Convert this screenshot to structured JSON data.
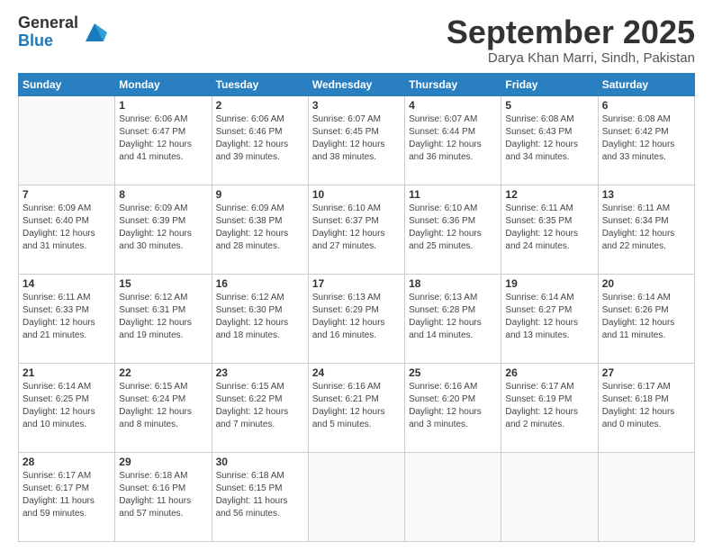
{
  "header": {
    "logo_general": "General",
    "logo_blue": "Blue",
    "title": "September 2025",
    "subtitle": "Darya Khan Marri, Sindh, Pakistan"
  },
  "days_of_week": [
    "Sunday",
    "Monday",
    "Tuesday",
    "Wednesday",
    "Thursday",
    "Friday",
    "Saturday"
  ],
  "weeks": [
    [
      {
        "day": "",
        "info": ""
      },
      {
        "day": "1",
        "info": "Sunrise: 6:06 AM\nSunset: 6:47 PM\nDaylight: 12 hours\nand 41 minutes."
      },
      {
        "day": "2",
        "info": "Sunrise: 6:06 AM\nSunset: 6:46 PM\nDaylight: 12 hours\nand 39 minutes."
      },
      {
        "day": "3",
        "info": "Sunrise: 6:07 AM\nSunset: 6:45 PM\nDaylight: 12 hours\nand 38 minutes."
      },
      {
        "day": "4",
        "info": "Sunrise: 6:07 AM\nSunset: 6:44 PM\nDaylight: 12 hours\nand 36 minutes."
      },
      {
        "day": "5",
        "info": "Sunrise: 6:08 AM\nSunset: 6:43 PM\nDaylight: 12 hours\nand 34 minutes."
      },
      {
        "day": "6",
        "info": "Sunrise: 6:08 AM\nSunset: 6:42 PM\nDaylight: 12 hours\nand 33 minutes."
      }
    ],
    [
      {
        "day": "7",
        "info": "Sunrise: 6:09 AM\nSunset: 6:40 PM\nDaylight: 12 hours\nand 31 minutes."
      },
      {
        "day": "8",
        "info": "Sunrise: 6:09 AM\nSunset: 6:39 PM\nDaylight: 12 hours\nand 30 minutes."
      },
      {
        "day": "9",
        "info": "Sunrise: 6:09 AM\nSunset: 6:38 PM\nDaylight: 12 hours\nand 28 minutes."
      },
      {
        "day": "10",
        "info": "Sunrise: 6:10 AM\nSunset: 6:37 PM\nDaylight: 12 hours\nand 27 minutes."
      },
      {
        "day": "11",
        "info": "Sunrise: 6:10 AM\nSunset: 6:36 PM\nDaylight: 12 hours\nand 25 minutes."
      },
      {
        "day": "12",
        "info": "Sunrise: 6:11 AM\nSunset: 6:35 PM\nDaylight: 12 hours\nand 24 minutes."
      },
      {
        "day": "13",
        "info": "Sunrise: 6:11 AM\nSunset: 6:34 PM\nDaylight: 12 hours\nand 22 minutes."
      }
    ],
    [
      {
        "day": "14",
        "info": "Sunrise: 6:11 AM\nSunset: 6:33 PM\nDaylight: 12 hours\nand 21 minutes."
      },
      {
        "day": "15",
        "info": "Sunrise: 6:12 AM\nSunset: 6:31 PM\nDaylight: 12 hours\nand 19 minutes."
      },
      {
        "day": "16",
        "info": "Sunrise: 6:12 AM\nSunset: 6:30 PM\nDaylight: 12 hours\nand 18 minutes."
      },
      {
        "day": "17",
        "info": "Sunrise: 6:13 AM\nSunset: 6:29 PM\nDaylight: 12 hours\nand 16 minutes."
      },
      {
        "day": "18",
        "info": "Sunrise: 6:13 AM\nSunset: 6:28 PM\nDaylight: 12 hours\nand 14 minutes."
      },
      {
        "day": "19",
        "info": "Sunrise: 6:14 AM\nSunset: 6:27 PM\nDaylight: 12 hours\nand 13 minutes."
      },
      {
        "day": "20",
        "info": "Sunrise: 6:14 AM\nSunset: 6:26 PM\nDaylight: 12 hours\nand 11 minutes."
      }
    ],
    [
      {
        "day": "21",
        "info": "Sunrise: 6:14 AM\nSunset: 6:25 PM\nDaylight: 12 hours\nand 10 minutes."
      },
      {
        "day": "22",
        "info": "Sunrise: 6:15 AM\nSunset: 6:24 PM\nDaylight: 12 hours\nand 8 minutes."
      },
      {
        "day": "23",
        "info": "Sunrise: 6:15 AM\nSunset: 6:22 PM\nDaylight: 12 hours\nand 7 minutes."
      },
      {
        "day": "24",
        "info": "Sunrise: 6:16 AM\nSunset: 6:21 PM\nDaylight: 12 hours\nand 5 minutes."
      },
      {
        "day": "25",
        "info": "Sunrise: 6:16 AM\nSunset: 6:20 PM\nDaylight: 12 hours\nand 3 minutes."
      },
      {
        "day": "26",
        "info": "Sunrise: 6:17 AM\nSunset: 6:19 PM\nDaylight: 12 hours\nand 2 minutes."
      },
      {
        "day": "27",
        "info": "Sunrise: 6:17 AM\nSunset: 6:18 PM\nDaylight: 12 hours\nand 0 minutes."
      }
    ],
    [
      {
        "day": "28",
        "info": "Sunrise: 6:17 AM\nSunset: 6:17 PM\nDaylight: 11 hours\nand 59 minutes."
      },
      {
        "day": "29",
        "info": "Sunrise: 6:18 AM\nSunset: 6:16 PM\nDaylight: 11 hours\nand 57 minutes."
      },
      {
        "day": "30",
        "info": "Sunrise: 6:18 AM\nSunset: 6:15 PM\nDaylight: 11 hours\nand 56 minutes."
      },
      {
        "day": "",
        "info": ""
      },
      {
        "day": "",
        "info": ""
      },
      {
        "day": "",
        "info": ""
      },
      {
        "day": "",
        "info": ""
      }
    ]
  ]
}
